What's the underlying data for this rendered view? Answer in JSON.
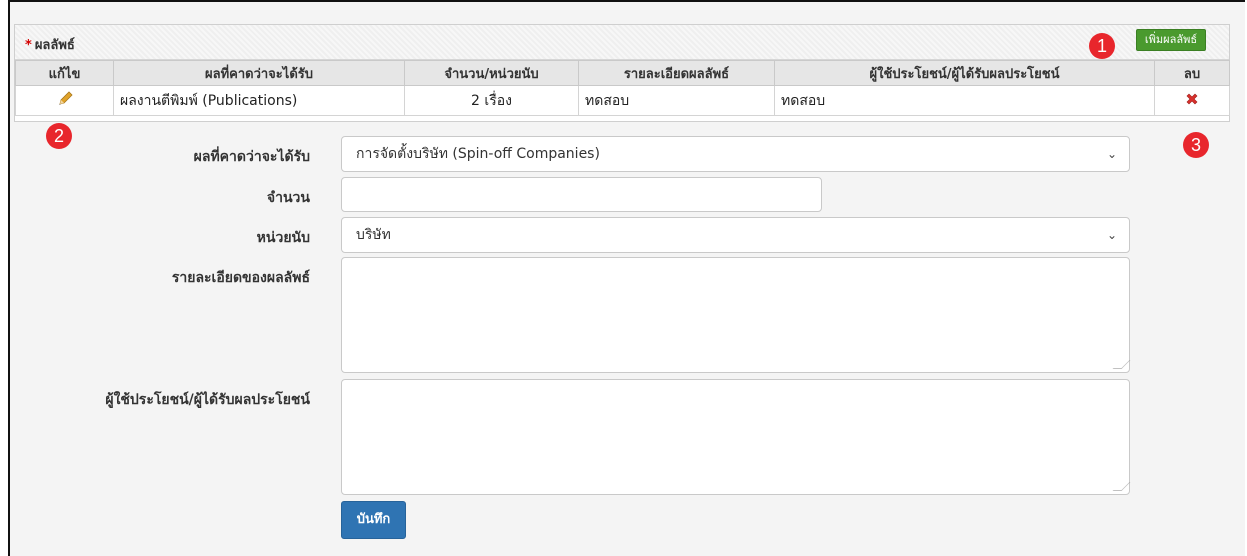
{
  "panel": {
    "required_mark": "*",
    "title": "ผลลัพธ์",
    "add_button": "เพิ่มผลลัพธ์"
  },
  "table": {
    "headers": [
      "แก้ไข",
      "ผลที่คาดว่าจะได้รับ",
      "จำนวน/หน่วยนับ",
      "รายละเอียดผลลัพธ์",
      "ผู้ใช้ประโยชน์/ผู้ได้รับผลประโยชน์",
      "ลบ"
    ],
    "rows": [
      {
        "edit_icon": "pencil-icon",
        "expected_result": "ผลงานตีพิมพ์ (Publications)",
        "quantity_unit": "2 เรื่อง",
        "detail": "ทดสอบ",
        "beneficiary": "ทดสอบ",
        "delete_icon": "x-icon"
      }
    ]
  },
  "badges": [
    "1",
    "2",
    "3"
  ],
  "form": {
    "expected_result": {
      "label": "ผลที่คาดว่าจะได้รับ",
      "value": "การจัดตั้งบริษัท (Spin-off Companies)"
    },
    "quantity": {
      "label": "จำนวน",
      "value": ""
    },
    "unit": {
      "label": "หน่วยนับ",
      "value": "บริษัท"
    },
    "detail": {
      "label": "รายละเอียดของผลลัพธ์",
      "value": ""
    },
    "beneficiary": {
      "label": "ผู้ใช้ประโยชน์/ผู้ได้รับผลประโยชน์",
      "value": ""
    },
    "save_button": "บันทึก"
  },
  "colors": {
    "add_button": "#4a9a2e",
    "save_button": "#2f74b3",
    "badge": "#e8262c",
    "required": "#d40000",
    "delete_icon": "#d9302c",
    "edit_icon": "#e0a32a"
  }
}
